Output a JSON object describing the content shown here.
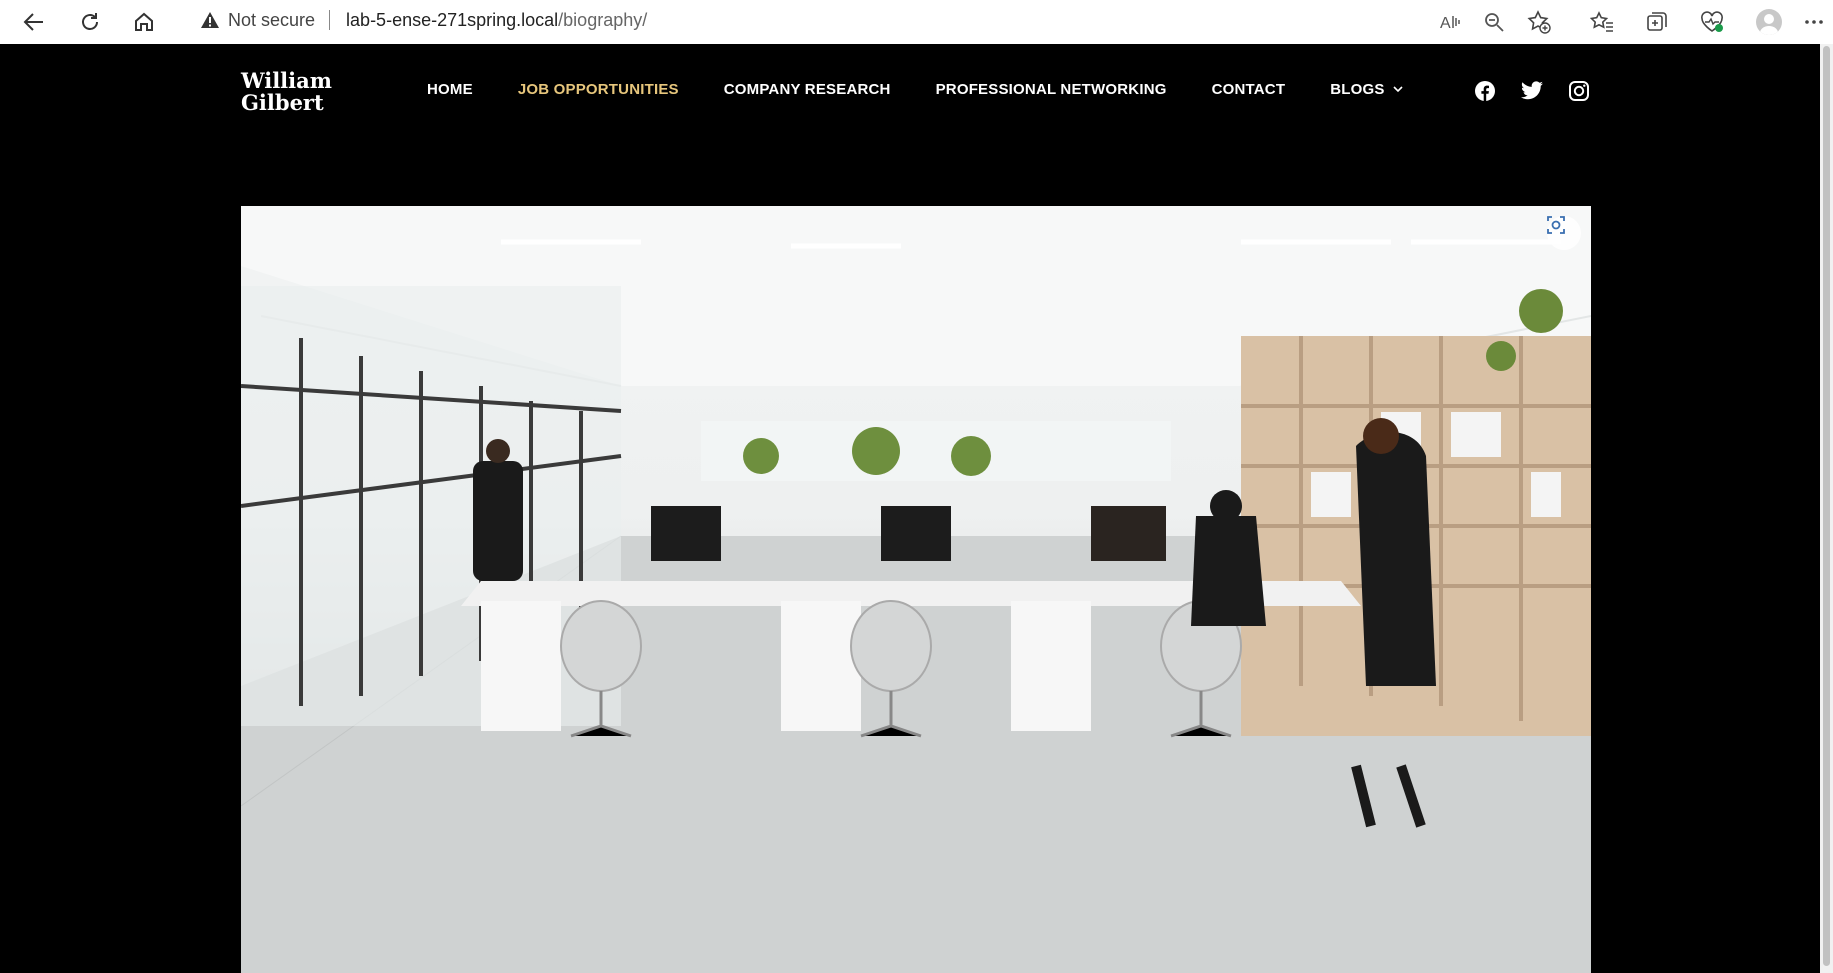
{
  "browser": {
    "security_label": "Not secure",
    "url_host": "lab-5-ense-271spring.local",
    "url_path": "/biography/"
  },
  "site": {
    "logo_line1": "William",
    "logo_line2": "Gilbert",
    "nav": [
      {
        "label": "HOME"
      },
      {
        "label": "JOB OPPORTUNITIES"
      },
      {
        "label": "COMPANY RESEARCH"
      },
      {
        "label": "PROFESSIONAL NETWORKING"
      },
      {
        "label": "CONTACT"
      },
      {
        "label": "BLOGS"
      }
    ],
    "active_nav_color": "#e7c67c",
    "social_icons": [
      "facebook-icon",
      "twitter-icon",
      "instagram-icon"
    ]
  },
  "hero": {
    "image_subject": "open-plan-office-photo"
  }
}
